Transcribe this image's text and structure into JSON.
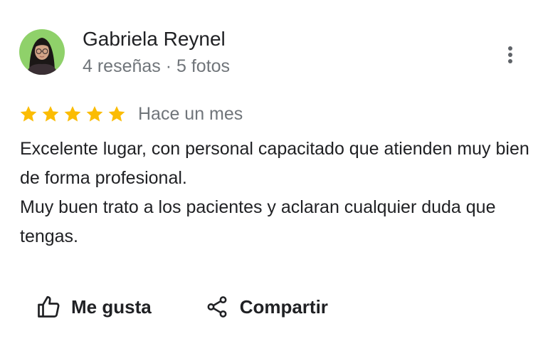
{
  "review": {
    "author": {
      "name": "Gabriela Reynel",
      "meta": "4 reseñas · 5 fotos"
    },
    "rating": 5,
    "rating_max": 5,
    "time_ago": "Hace un mes",
    "text": "Excelente lugar, con personal capacitado que atienden muy bien de forma profesional.\nMuy buen trato a los pacientes y aclaran cualquier duda que tengas.",
    "actions": {
      "like_label": "Me gusta",
      "share_label": "Compartir"
    }
  },
  "icons": {
    "more": "more-vertical-icon",
    "star": "star-icon",
    "like": "thumb-up-icon",
    "share": "share-icon"
  },
  "colors": {
    "star": "#fbbc04",
    "text": "#202124",
    "secondary_text": "#70757a",
    "avatar_background": "#8fd16a"
  }
}
